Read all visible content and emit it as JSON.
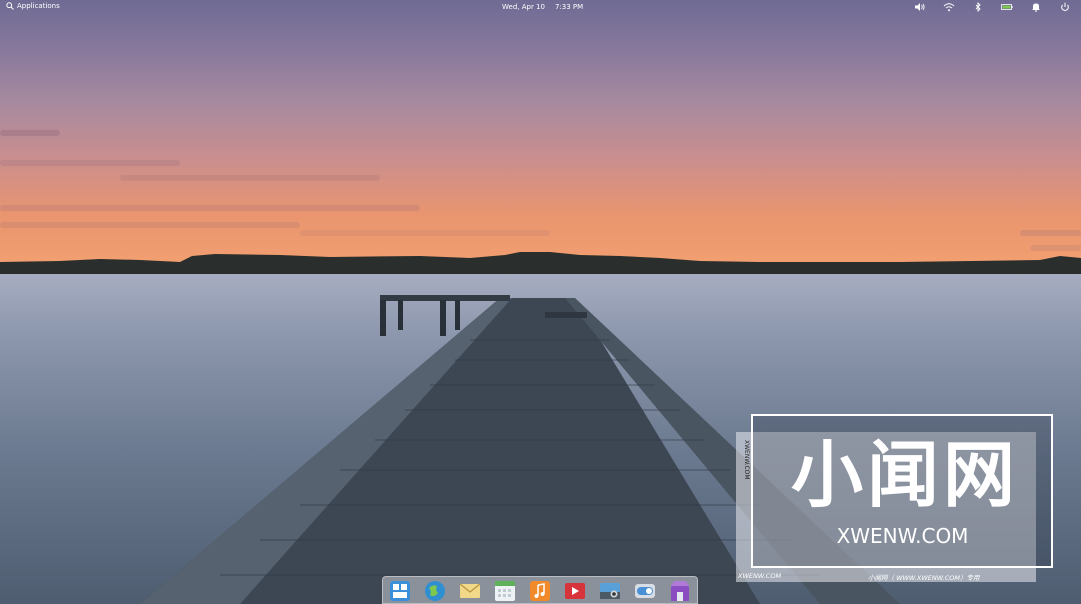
{
  "top_panel": {
    "applications_label": "Applications",
    "date": "Wed, Apr 10",
    "time": "7:33 PM",
    "tray_icons": [
      "volume-icon",
      "wifi-icon",
      "bluetooth-icon",
      "battery-icon",
      "notifications-icon",
      "power-icon"
    ]
  },
  "watermark": {
    "chinese_title": "小闻网",
    "english_site": "XWENW.COM",
    "vertical_text": "XWENW.COM",
    "bottom_left": "XWENW.COM",
    "bottom_right": "小闻网（ WWW.XWENW.COM）专用"
  },
  "dock": {
    "items": [
      {
        "name": "multitasking-view",
        "color": "#3b8fd8"
      },
      {
        "name": "web-browser",
        "color": "#2f8fd0"
      },
      {
        "name": "mail",
        "color": "#e6c56a"
      },
      {
        "name": "calendar",
        "color": "#e9eef2"
      },
      {
        "name": "music",
        "color": "#f08a2a"
      },
      {
        "name": "videos",
        "color": "#d6343a"
      },
      {
        "name": "photos",
        "color": "#5aa0d8"
      },
      {
        "name": "system-settings",
        "color": "#d8dde3"
      },
      {
        "name": "app-center",
        "color": "#8a4ec0"
      }
    ]
  },
  "colors": {
    "sky_top": "#6f6b94",
    "sky_bottom": "#f3a070",
    "water": "#6b7a90",
    "pier": "#3a4452"
  }
}
